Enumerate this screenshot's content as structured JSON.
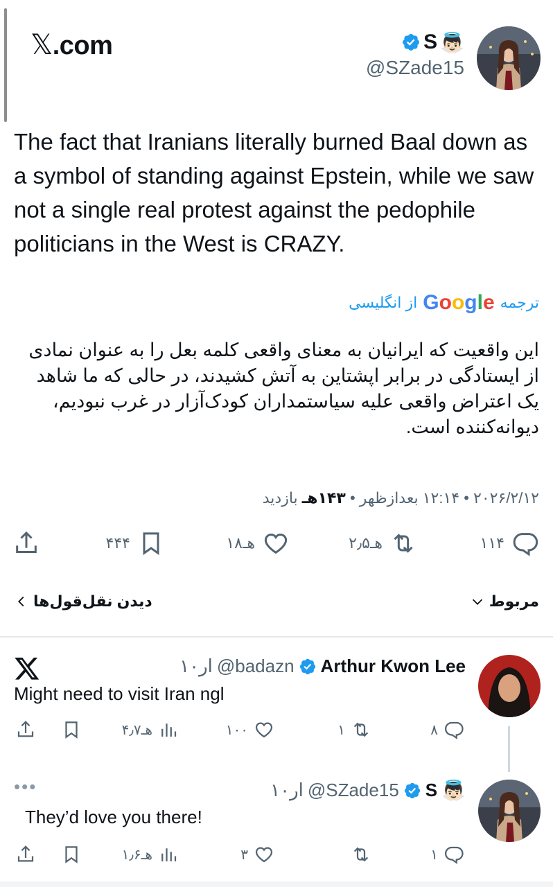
{
  "brand": {
    "x_glyph": "𝕏",
    "domain": ".com"
  },
  "tweet": {
    "author_name": "S",
    "author_emoji": "👼🏻",
    "author_handle": "@SZade15",
    "text": "The fact that Iranians literally burned Baal down as a symbol of standing against Epstein, while we saw not a single real protest against the pedophile politicians in the West is CRAZY.",
    "translate_prefix": "ترجمه",
    "translate_brand": "Google",
    "translate_suffix": "از انگلیسی",
    "translation": "این واقعیت که ایرانیان به معنای واقعی کلمه بعل را به عنوان نمادی از ایستادگی در برابر اپشتاین به آتش کشیدند، در حالی که ما شاهد یک اعتراض واقعی علیه سیاستمداران کودک‌آزار در غرب نبودیم، دیوانه‌کننده است.",
    "meta_date": "۲۰۲۶/۲/۱۲ • ۱۲:۱۴ بعدازظهر • ",
    "meta_views": "۱۴۳هـ",
    "meta_views_label": " بازدید",
    "replies": "۱۱۴",
    "reposts": "۲٫۵هـ",
    "likes": "۱۸هـ",
    "bookmarks": "۴۴۴"
  },
  "related": {
    "label": "مربوط",
    "quotes_label": "دیدن نقل‌قول‌ها"
  },
  "reply1": {
    "name": "Arthur Kwon Lee",
    "handle": "@badazn",
    "time": "۱۰ار",
    "text": "Might need to visit Iran ngl",
    "replies": "۸",
    "reposts": "۱",
    "likes": "۱۰۰",
    "views": "۴٫۷هـ"
  },
  "reply2": {
    "name": "S",
    "emoji": "👼🏻",
    "handle": "@SZade15",
    "time": "۱۰ار",
    "text": "They’d love you there!",
    "more": "•••",
    "replies": "۱",
    "reposts": "",
    "likes": "۳",
    "views": "۱٫۶هـ"
  },
  "colors": {
    "blue": "#1d9bf0",
    "gray": "#536471",
    "text": "#0f1419"
  }
}
